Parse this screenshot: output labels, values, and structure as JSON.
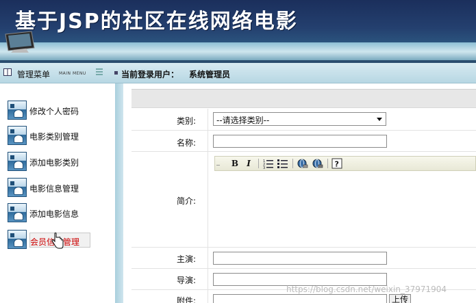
{
  "header": {
    "title": "基于JSP的社区在线网络电影"
  },
  "nav": {
    "menu_title": "管理菜单",
    "menu_subtitle": "MAIN MENU",
    "current_user_label": "当前登录用户：",
    "current_user": "系统管理员"
  },
  "sidebar": {
    "items": [
      {
        "label": "修改个人密码",
        "icon": "admin-tool-icon"
      },
      {
        "label": "电影类别管理",
        "icon": "admin-tool-icon"
      },
      {
        "label": "添加电影类别",
        "icon": "admin-tool-icon"
      },
      {
        "label": "电影信息管理",
        "icon": "admin-tool-icon"
      },
      {
        "label": "添加电影信息",
        "icon": "admin-tool-icon"
      },
      {
        "label": "会员信息管理",
        "icon": "admin-tool-icon",
        "active": true
      }
    ]
  },
  "form": {
    "category_label": "类别:",
    "category_selected": "--请选择类别--",
    "name_label": "名称:",
    "intro_label": "简介:",
    "actors_label": "主演:",
    "director_label": "导演:",
    "attachment_label": "附件:",
    "upload_button": "上传",
    "editor_tools": [
      "B",
      "I",
      "ordered-list-icon",
      "unordered-list-icon",
      "link-icon",
      "unlink-icon",
      "help-icon"
    ]
  },
  "watermark": "https://blog.csdn.net/weixin_37971904",
  "colors": {
    "banner": "#24406f",
    "navbar": "#b7d7e3",
    "active_item_text": "#cc0000"
  }
}
